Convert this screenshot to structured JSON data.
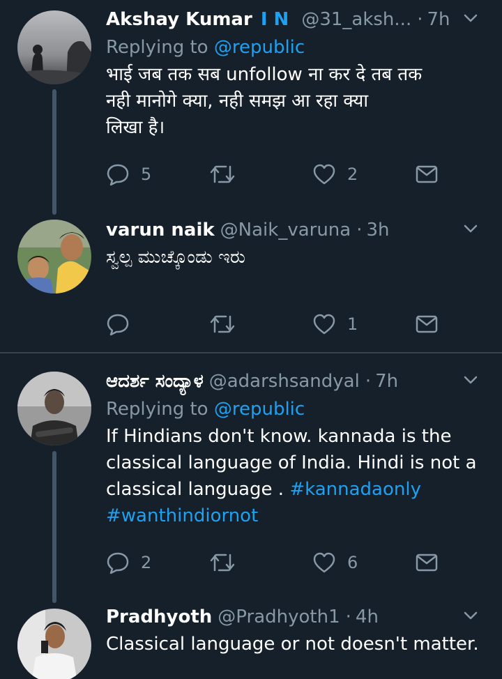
{
  "tweets": [
    {
      "name": "Akshay Kumar",
      "badge": "I N",
      "handle": "@31_aksh...",
      "time": "7h",
      "replying_prefix": "Replying to",
      "replying_handle": "@republic",
      "text_lines": [
        "भाई जब तक सब unfollow ना कर दे तब तक",
        "नही मानोगे क्या, नही समझ आ रहा क्या",
        "लिखा है।"
      ],
      "replies": "5",
      "retweets": "",
      "likes": "2"
    },
    {
      "name": "varun naik",
      "handle": "@Naik_varuna",
      "time": "3h",
      "text_lines": [
        "ಸ್ವಲ್ಪ ಮುಚ್ಕೊಂಡು ಇರು"
      ],
      "replies": "",
      "retweets": "",
      "likes": "1"
    },
    {
      "name": "ಆದರ್ಶ ಸಂದ್ಯಾಳ",
      "handle": "@adarshsandyal",
      "time": "7h",
      "replying_prefix": "Replying to",
      "replying_handle": "@republic",
      "text_lines": [
        "If Hindians don't know. kannada is the",
        "classical language of India. Hindi is not a",
        "classical language ."
      ],
      "hashtags": [
        "#kannadaonly",
        "#wanthindiornot"
      ],
      "replies": "2",
      "retweets": "",
      "likes": "6"
    },
    {
      "name": "Pradhyoth",
      "handle": "@Pradhyoth1",
      "time": "4h",
      "text_lines": [
        "Classical language or not doesn't matter."
      ]
    }
  ],
  "sep": "·",
  "colors": {
    "background": "#15202b",
    "text": "#ffffff",
    "secondary": "#8899a6",
    "accent": "#1da1f2",
    "thread_line": "#42566a",
    "separator": "#38444d"
  },
  "icons": [
    "reply-icon",
    "retweet-icon",
    "like-icon",
    "message-icon",
    "chevron-down-icon"
  ]
}
